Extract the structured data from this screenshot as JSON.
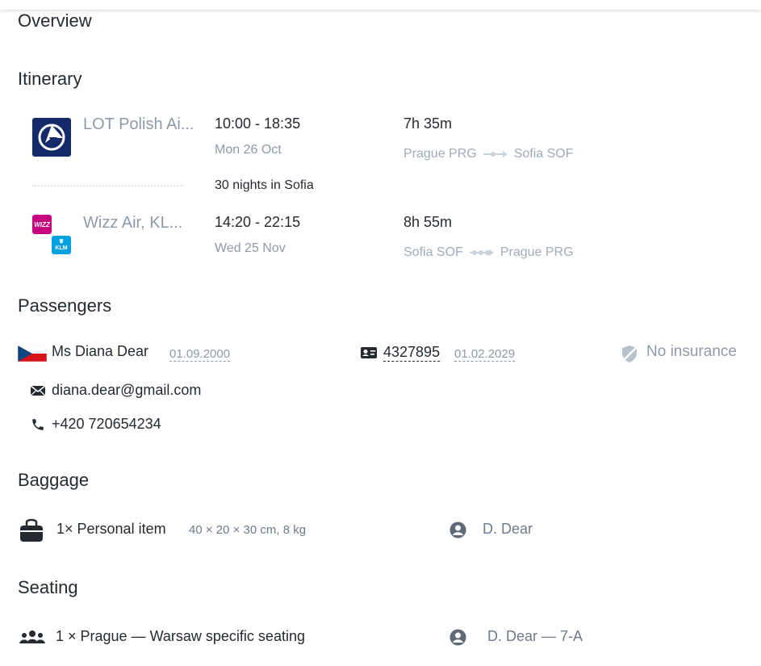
{
  "sections": {
    "overview": "Overview",
    "itinerary": "Itinerary",
    "passengers": "Passengers",
    "baggage": "Baggage",
    "seating": "Seating"
  },
  "itinerary": {
    "outbound": {
      "carrier": "LOT Polish Ai...",
      "time": "10:00 - 18:35",
      "date": "Mon 26 Oct",
      "duration": "7h 35m",
      "from": "Prague PRG",
      "to": "Sofia SOF",
      "icons": [
        "lot-logo"
      ]
    },
    "stay": "30 nights in Sofia",
    "return": {
      "carrier": "Wizz Air, KL...",
      "time": "14:20 - 22:15",
      "date": "Wed 25 Nov",
      "duration": "8h 55m",
      "from": "Sofia SOF",
      "to": "Prague PRG",
      "icons": [
        "wizz-logo",
        "klm-logo"
      ],
      "logo_text": {
        "wizz": "WIZZ",
        "klm": "KLM"
      }
    }
  },
  "passenger": {
    "name": "Ms Diana Dear",
    "birthdate": "01.09.2000",
    "document_number": "4327895",
    "document_expiry": "01.02.2029",
    "insurance": "No insurance",
    "email": "diana.dear@gmail.com",
    "phone": "+420 720654234",
    "flag": "czech-flag"
  },
  "baggage": {
    "item": "1× Personal item",
    "dimensions": "40 × 20 × 30 cm, 8 kg",
    "owner": "D. Dear"
  },
  "seating": {
    "item": "1 × Prague — Warsaw specific seating",
    "assignment": "D. Dear — 7-A"
  },
  "colors": {
    "lot_blue": "#142a6b",
    "wizz_magenta": "#c6007e",
    "klm_blue": "#00a1de",
    "text": "#252a31",
    "muted": "#8f9aa8"
  }
}
